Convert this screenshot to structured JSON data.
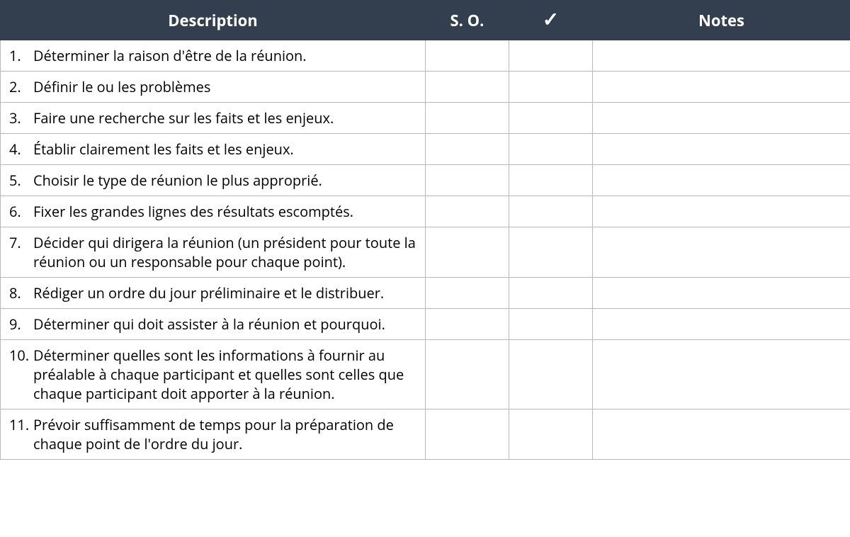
{
  "headers": {
    "description": "Description",
    "so": "S. O.",
    "check": "✓",
    "notes": "Notes"
  },
  "rows": [
    {
      "n": "1.",
      "desc": "Déterminer la raison d'être de la réunion.",
      "so": "",
      "check": "",
      "notes": ""
    },
    {
      "n": "2.",
      "desc": "Définir le ou les problèmes",
      "so": "",
      "check": "",
      "notes": ""
    },
    {
      "n": "3.",
      "desc": "Faire une recherche sur les faits et les enjeux.",
      "so": "",
      "check": "",
      "notes": ""
    },
    {
      "n": "4.",
      "desc": "Établir clairement les faits et les enjeux.",
      "so": "",
      "check": "",
      "notes": ""
    },
    {
      "n": "5.",
      "desc": "Choisir le type de réunion le plus approprié.",
      "so": "",
      "check": "",
      "notes": ""
    },
    {
      "n": "6.",
      "desc": "Fixer les grandes lignes des résultats escomptés.",
      "so": "",
      "check": "",
      "notes": ""
    },
    {
      "n": "7.",
      "desc": "Décider qui dirigera la réunion (un président pour toute la réunion ou un responsable pour chaque point).",
      "so": "",
      "check": "",
      "notes": ""
    },
    {
      "n": "8.",
      "desc": "Rédiger un ordre du jour préliminaire et le distribuer.",
      "so": "",
      "check": "",
      "notes": ""
    },
    {
      "n": "9.",
      "desc": "Déterminer qui doit assister à la réunion et pourquoi.",
      "so": "",
      "check": "",
      "notes": ""
    },
    {
      "n": "10.",
      "desc": "Déterminer quelles sont les informations à fournir au préalable à chaque participant et quelles sont celles que chaque participant doit apporter à la réunion.",
      "so": "",
      "check": "",
      "notes": ""
    },
    {
      "n": "11.",
      "desc": "Prévoir suffisamment de temps pour la préparation de chaque point de l'ordre du jour.",
      "so": "",
      "check": "",
      "notes": ""
    }
  ]
}
